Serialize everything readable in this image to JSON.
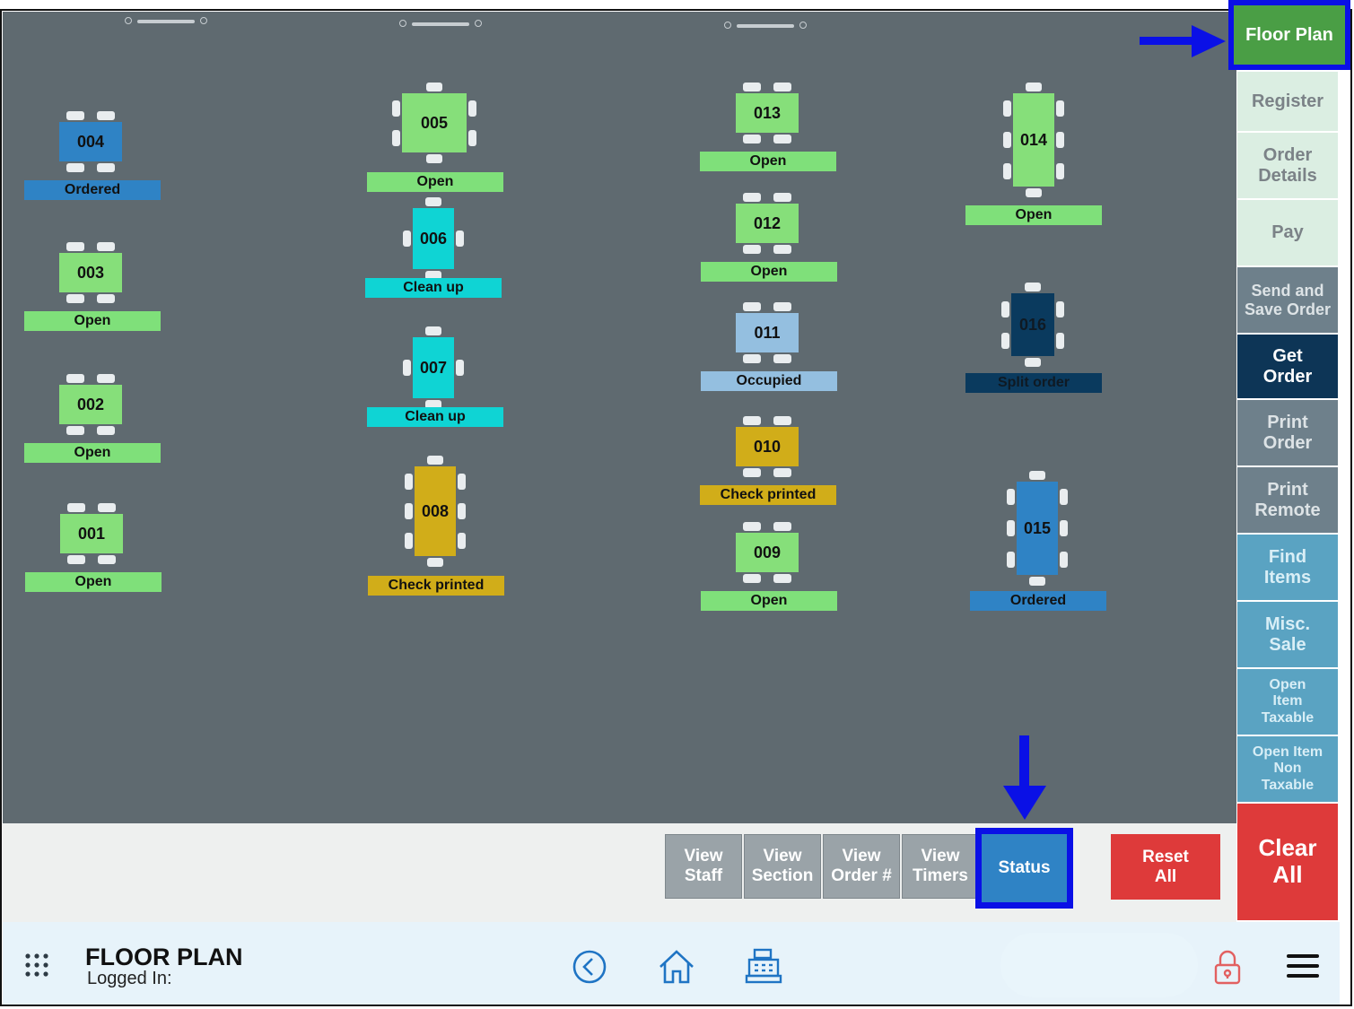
{
  "floor": {
    "tables": [
      {
        "id": "004",
        "status": "Ordered",
        "color": "#2f83c5",
        "status_color": "#2f83c5"
      },
      {
        "id": "003",
        "status": "Open",
        "color": "#86df7a",
        "status_color": "#7fe07a"
      },
      {
        "id": "002",
        "status": "Open",
        "color": "#86df7a",
        "status_color": "#7fe07a"
      },
      {
        "id": "001",
        "status": "Open",
        "color": "#86df7a",
        "status_color": "#7fe07a"
      },
      {
        "id": "005",
        "status": "Open",
        "color": "#86df7a",
        "status_color": "#7fe07a"
      },
      {
        "id": "006",
        "status": "Clean up",
        "color": "#0fd4d4",
        "status_color": "#0fd4d4"
      },
      {
        "id": "007",
        "status": "Clean up",
        "color": "#0fd4d4",
        "status_color": "#0fd4d4"
      },
      {
        "id": "008",
        "status": "Check printed",
        "color": "#d1ad19",
        "status_color": "#d1ad19"
      },
      {
        "id": "013",
        "status": "Open",
        "color": "#86df7a",
        "status_color": "#7fe07a"
      },
      {
        "id": "012",
        "status": "Open",
        "color": "#86df7a",
        "status_color": "#7fe07a"
      },
      {
        "id": "011",
        "status": "Occupied",
        "color": "#94bfe0",
        "status_color": "#94bfe0"
      },
      {
        "id": "010",
        "status": "Check printed",
        "color": "#d1ad19",
        "status_color": "#d1ad19"
      },
      {
        "id": "009",
        "status": "Open",
        "color": "#86df7a",
        "status_color": "#7fe07a"
      },
      {
        "id": "014",
        "status": "Open",
        "color": "#86df7a",
        "status_color": "#7fe07a"
      },
      {
        "id": "016",
        "status": "Split order",
        "color": "#0a3a5e",
        "status_color": "#0a3a5e"
      },
      {
        "id": "015",
        "status": "Ordered",
        "color": "#2f83c5",
        "status_color": "#2f83c5"
      }
    ]
  },
  "sidebar": {
    "floor_plan": "Floor Plan",
    "register": "Register",
    "order_details": "Order Details",
    "pay": "Pay",
    "send_save": "Send and Save Order",
    "get_order": "Get Order",
    "print_order": "Print Order",
    "print_remote": "Print Remote",
    "find_items": "Find Items",
    "misc_sale": "Misc. Sale",
    "open_item_taxable": "Open Item Taxable",
    "open_item_non_taxable": "Open Item Non Taxable",
    "clear_all": "Clear All"
  },
  "bottom": {
    "view_staff": "View Staff",
    "view_section": "View Section",
    "view_order": "View Order #",
    "view_timers": "View Timers",
    "status": "Status",
    "reset_all": "Reset All"
  },
  "footer": {
    "title": "FLOOR PLAN",
    "logged_in": "Logged In:"
  },
  "icons": [
    "grid-menu-icon",
    "back-circle-icon",
    "home-icon",
    "cash-register-icon",
    "lock-icon",
    "hamburger-menu-icon"
  ],
  "colors": {
    "highlight": "#0a10e6",
    "floor_bg": "#5f6a70",
    "clear_red": "#de3a3a",
    "open_green": "#86df7a"
  }
}
